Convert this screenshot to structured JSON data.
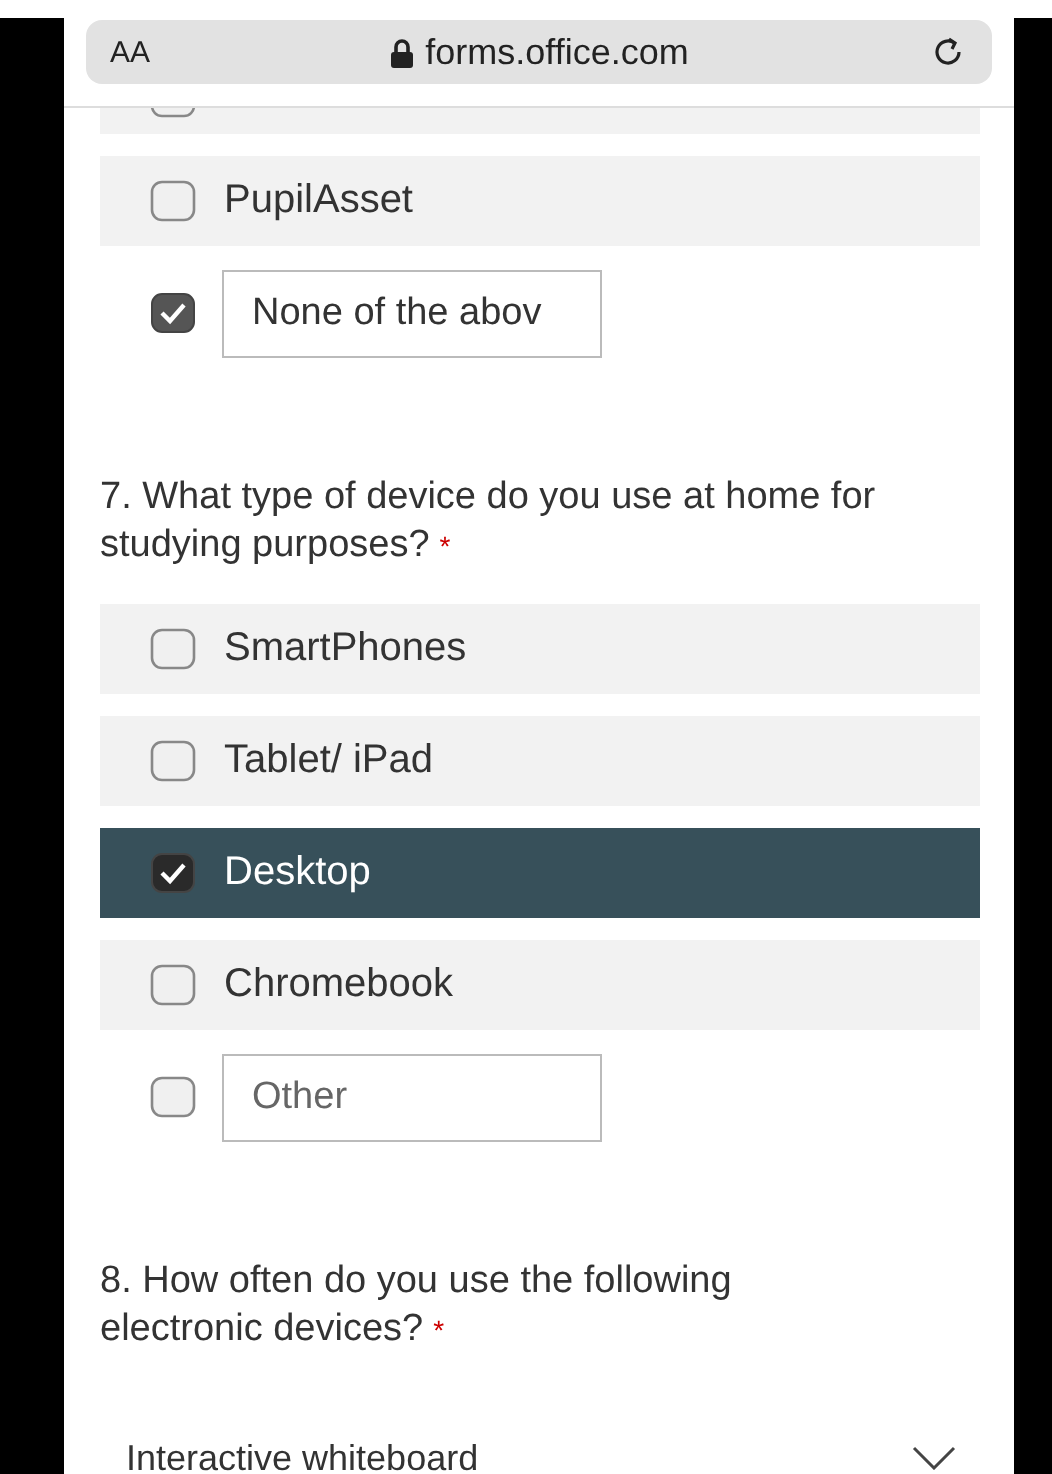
{
  "browser": {
    "text_size_button": "AA",
    "url": "forms.office.com"
  },
  "questions": [
    {
      "options": [
        {
          "kind": "partial",
          "checked": false
        },
        {
          "kind": "choice",
          "label": "PupilAsset",
          "checked": false
        },
        {
          "kind": "other",
          "value": "None of the abov",
          "checked": true
        }
      ]
    },
    {
      "title": "7. What type of device do you use at home for studying purposes?",
      "required_mark": "*",
      "options": [
        {
          "kind": "choice",
          "label": "SmartPhones",
          "checked": false
        },
        {
          "kind": "choice",
          "label": "Tablet/ iPad",
          "checked": false
        },
        {
          "kind": "choice",
          "label": "Desktop",
          "checked": true
        },
        {
          "kind": "choice",
          "label": "Chromebook",
          "checked": false
        },
        {
          "kind": "other",
          "placeholder": "Other",
          "checked": false
        }
      ]
    },
    {
      "title": "8. How often do you use the following electronic devices?",
      "required_mark": "*",
      "dropdown": {
        "label": "Interactive whiteboard"
      }
    }
  ]
}
